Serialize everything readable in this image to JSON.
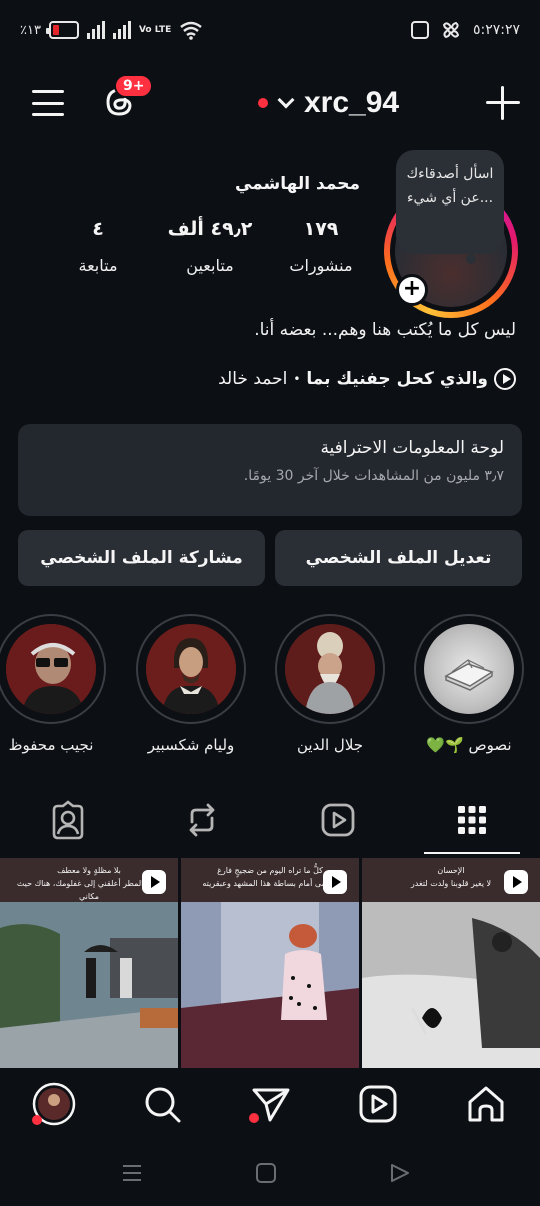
{
  "status_bar": {
    "battery": "٪١٣",
    "network": "Vo LTE",
    "time": "٥:٢٧:٢٧"
  },
  "header": {
    "notification_badge": "9+",
    "username": "xrc_94"
  },
  "profile": {
    "note": "اسأل أصدقاءك عن أي شيء...",
    "display_name": "محمد الهاشمي",
    "stats": [
      {
        "value": "١٧٩",
        "label": "منشورات"
      },
      {
        "value": "٤٩٫٢ ألف",
        "label": "متابعين"
      },
      {
        "value": "٤",
        "label": "متابعة"
      }
    ],
    "bio": "ليس كل ما يُكتب هنا وهم... بعضه أنا.",
    "music": {
      "song": "والذي كحل جفنيك بما",
      "separator": "•",
      "artist": "احمد خالد"
    }
  },
  "dashboard": {
    "title": "لوحة المعلومات الاحترافية",
    "subtitle": "٣٫٧ مليون من المشاهدات خلال آخر 30 يومًا."
  },
  "buttons": {
    "edit": "تعديل الملف الشخصي",
    "share": "مشاركة الملف الشخصي"
  },
  "highlights": [
    {
      "label": "نصوص 🌱💚"
    },
    {
      "label": "جلال الدين"
    },
    {
      "label": "وليام شكسبير"
    },
    {
      "label": "نجيب محفوظ"
    }
  ],
  "posts": [
    {
      "caption_line1": "الإحسان",
      "caption_line2": "لا يغير قلوبنا ولدت لتغدر"
    },
    {
      "caption_line1": "كلُّ ما تراه اليوم من ضجيجٍ فارغ",
      "caption_line2": "يتلاشى أمام بساطة هذا المشهد وعبقريته"
    },
    {
      "caption_line1": "بلا مظلةٍ ولا معطف",
      "caption_line2": "تحت المطر أعلقني إلى غفلومك، هناك حيث مكاني"
    }
  ],
  "colors": {
    "background": "#0c0f14",
    "accent_red": "#ff3040",
    "card": "#23272e",
    "button": "#2a2e35"
  }
}
